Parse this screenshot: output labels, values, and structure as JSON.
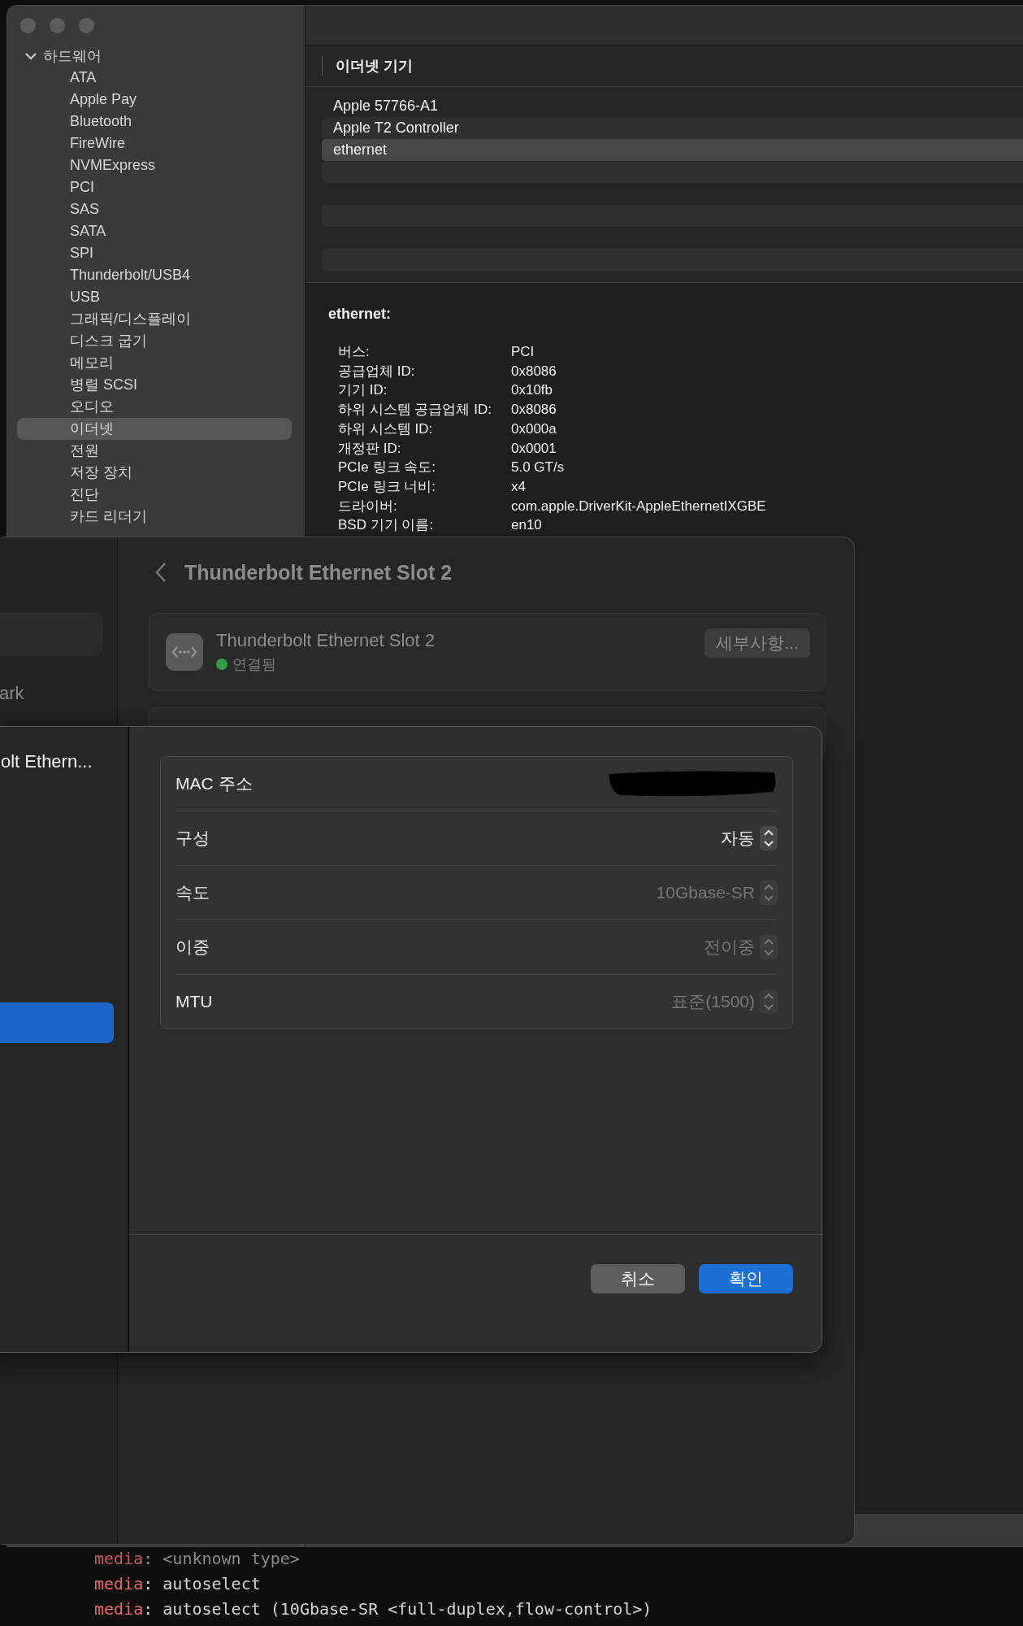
{
  "system_info": {
    "sidebar": {
      "groups": [
        {
          "label": "하드웨어",
          "expanded": true,
          "items": [
            {
              "label": "ATA",
              "selected": false
            },
            {
              "label": "Apple Pay",
              "selected": false
            },
            {
              "label": "Bluetooth",
              "selected": false
            },
            {
              "label": "FireWire",
              "selected": false
            },
            {
              "label": "NVMExpress",
              "selected": false
            },
            {
              "label": "PCI",
              "selected": false
            },
            {
              "label": "SAS",
              "selected": false
            },
            {
              "label": "SATA",
              "selected": false
            },
            {
              "label": "SPI",
              "selected": false
            },
            {
              "label": "Thunderbolt/USB4",
              "selected": false
            },
            {
              "label": "USB",
              "selected": false
            },
            {
              "label": "그래픽/디스플레이",
              "selected": false
            },
            {
              "label": "디스크 굽기",
              "selected": false
            },
            {
              "label": "메모리",
              "selected": false
            },
            {
              "label": "병렬 SCSI",
              "selected": false
            },
            {
              "label": "오디오",
              "selected": false
            },
            {
              "label": "이더넷",
              "selected": true
            },
            {
              "label": "전원",
              "selected": false
            },
            {
              "label": "저장 장치",
              "selected": false
            },
            {
              "label": "진단",
              "selected": false
            },
            {
              "label": "카드 리더기",
              "selected": false
            }
          ]
        }
      ]
    },
    "device_list": {
      "header": "이더넷 기기",
      "rows": [
        {
          "label": "Apple 57766-A1",
          "selected": false
        },
        {
          "label": "Apple T2 Controller",
          "selected": false
        },
        {
          "label": "ethernet",
          "selected": true
        }
      ]
    },
    "details": {
      "title": "ethernet:",
      "fields": [
        {
          "label": "버스:",
          "value": "PCI"
        },
        {
          "label": "공급업체 ID:",
          "value": "0x8086"
        },
        {
          "label": "기기 ID:",
          "value": "0x10fb"
        },
        {
          "label": "하위 시스템 공급업체 ID:",
          "value": "0x8086"
        },
        {
          "label": "하위 시스템 ID:",
          "value": "0x000a"
        },
        {
          "label": "개정판 ID:",
          "value": "0x0001"
        },
        {
          "label": "PCIe 링크 속도:",
          "value": "5.0 GT/s"
        },
        {
          "label": "PCIe 링크 너비:",
          "value": "x4"
        },
        {
          "label": "드라이버:",
          "value": "com.apple.DriverKit-AppleEthernetIXGBE"
        },
        {
          "label": "BSD 기기 이름:",
          "value": "en10"
        }
      ]
    }
  },
  "network_settings": {
    "sidebar_item": "ark",
    "title": "Thunderbolt Ethernet Slot 2",
    "interface": {
      "name": "Thunderbolt Ethernet Slot 2",
      "status": "연결됨",
      "connected": true,
      "details_button": "세부사항..."
    }
  },
  "dialog": {
    "sidebar_item": "olt Ethern...",
    "rows": [
      {
        "label": "MAC 주소",
        "kind": "redacted"
      },
      {
        "label": "구성",
        "kind": "popup",
        "value": "자동",
        "disabled": false
      },
      {
        "label": "속도",
        "kind": "popup",
        "value": "10Gbase-SR",
        "disabled": true
      },
      {
        "label": "이중",
        "kind": "popup",
        "value": "전이중",
        "disabled": true
      },
      {
        "label": "MTU",
        "kind": "popup",
        "value": "표준(1500)",
        "disabled": true
      }
    ],
    "buttons": [
      {
        "label": "취소",
        "kind": "secondary"
      },
      {
        "label": "확인",
        "kind": "primary"
      }
    ]
  },
  "terminal": {
    "lines": [
      {
        "key": "media",
        "separator": ":",
        "value": "<unknown type>",
        "dim": true
      },
      {
        "key": "media",
        "separator": ":",
        "value": "autoselect",
        "dim": false
      },
      {
        "key": "media",
        "separator": ":",
        "value": "autoselect (10Gbase-SR <full-duplex,flow-control>)",
        "dim": false
      }
    ]
  }
}
